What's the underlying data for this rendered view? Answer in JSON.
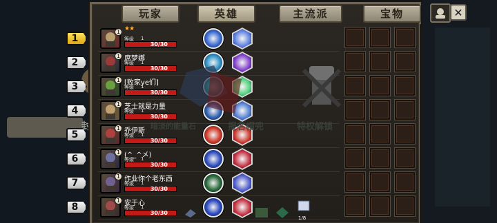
{
  "tabs": [
    "玩家",
    "英雄",
    "主流派",
    "宝物"
  ],
  "active_tab": 1,
  "top_right": {
    "close_icon": "✕",
    "profile_icon": "avatar-icon"
  },
  "background_text": {
    "left": "封",
    "stone": "暗淡的能量石",
    "helmet": "报名帽兜",
    "privilege": "特权解锁"
  },
  "level_label": "等级",
  "players": [
    {
      "rank": "1",
      "name": "",
      "stars": "★★",
      "level": "1",
      "hp": "30/30",
      "skill_color": "#3a6bd4",
      "hex_color": "#5a7ee0"
    },
    {
      "rank": "2",
      "name": "席梦娜",
      "stars": "",
      "level": "1",
      "hp": "30/30",
      "skill_color": "#2f93c9",
      "hex_color": "#7e3cc9"
    },
    {
      "rank": "3",
      "name": "[败家ye们]",
      "stars": "",
      "level": "1",
      "hp": "30/30",
      "skill_color": "#1c9a8a",
      "hex_color": "#4dd17a"
    },
    {
      "rank": "4",
      "name": "芝士就是力量",
      "stars": "",
      "level": "1",
      "hp": "30/30",
      "skill_color": "#2d5fb0",
      "hex_color": "#4d7ad0"
    },
    {
      "rank": "5",
      "name": "乔伊斯",
      "stars": "",
      "level": "1",
      "hp": "30/30",
      "skill_color": "#d13b2a",
      "hex_color": "#c9342a"
    },
    {
      "rank": "6",
      "name": "(^_^メ)",
      "stars": "",
      "level": "1",
      "hp": "30/30",
      "skill_color": "#2f4fc0",
      "hex_color": "#c02b3d"
    },
    {
      "rank": "7",
      "name": "作业你个老东西",
      "stars": "",
      "level": "1",
      "hp": "30/30",
      "skill_color": "#2a6a3a",
      "hex_color": "#4a58c8"
    },
    {
      "rank": "8",
      "name": "安于心",
      "stars": "",
      "level": "1",
      "hp": "30/30",
      "skill_color": "#2b4ac2",
      "hex_color": "#c22d3c"
    }
  ],
  "footer": {
    "counter": "1/8"
  }
}
